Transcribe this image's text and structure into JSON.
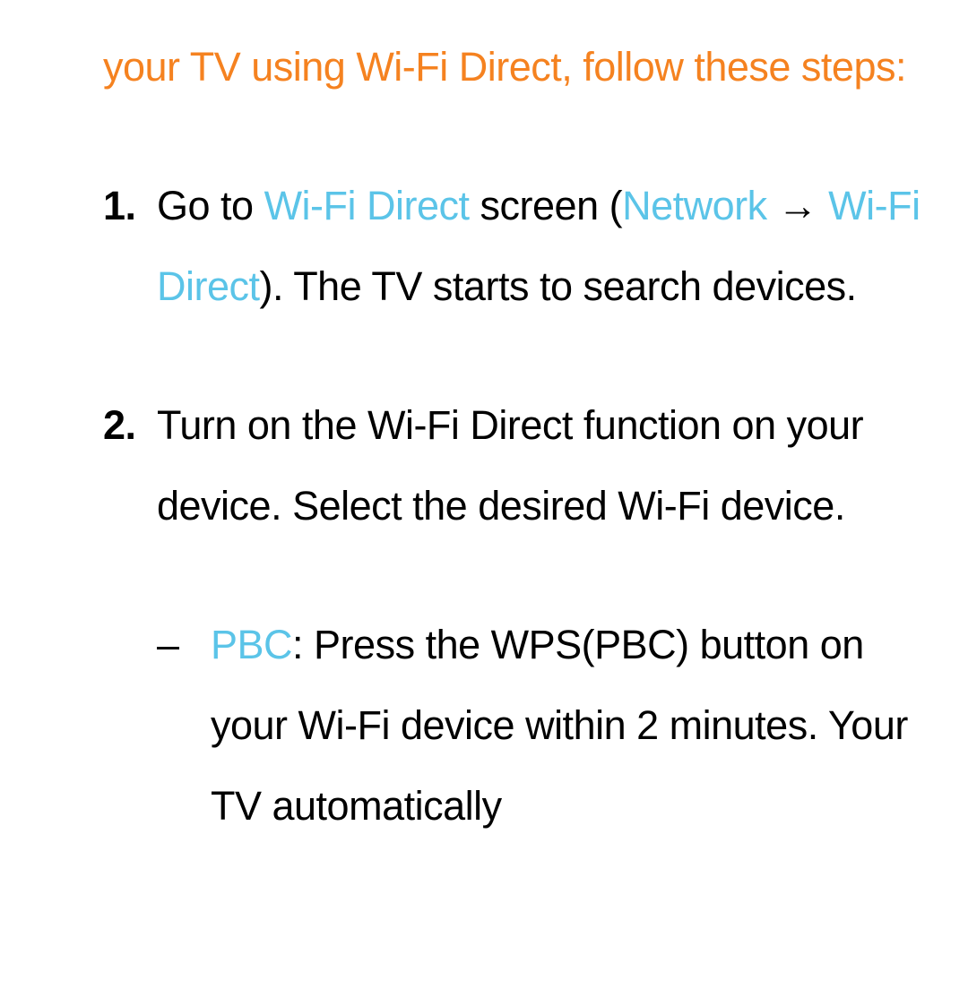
{
  "colors": {
    "orange": "#f58220",
    "cyan": "#5bc4e8",
    "black": "#000000"
  },
  "intro": "your TV using Wi-Fi Direct, follow these steps:",
  "steps": [
    {
      "num": "1.",
      "parts": [
        {
          "t": "Go to ",
          "hl": false
        },
        {
          "t": "Wi-Fi Direct",
          "hl": true
        },
        {
          "t": " screen (",
          "hl": false
        },
        {
          "t": "Network",
          "hl": true
        },
        {
          "t": " → ",
          "hl": false
        },
        {
          "t": "Wi-Fi Direct",
          "hl": true
        },
        {
          "t": "). The TV starts to search devices.",
          "hl": false
        }
      ]
    },
    {
      "num": "2.",
      "parts": [
        {
          "t": "Turn on the Wi-Fi Direct function on your device. Select the desired Wi-Fi device.",
          "hl": false
        }
      ]
    }
  ],
  "sub": {
    "dash": "–",
    "parts": [
      {
        "t": "PBC",
        "hl": true
      },
      {
        "t": ": Press the WPS(PBC) button on your Wi-Fi device within 2 minutes. Your TV automatically",
        "hl": false
      }
    ]
  }
}
